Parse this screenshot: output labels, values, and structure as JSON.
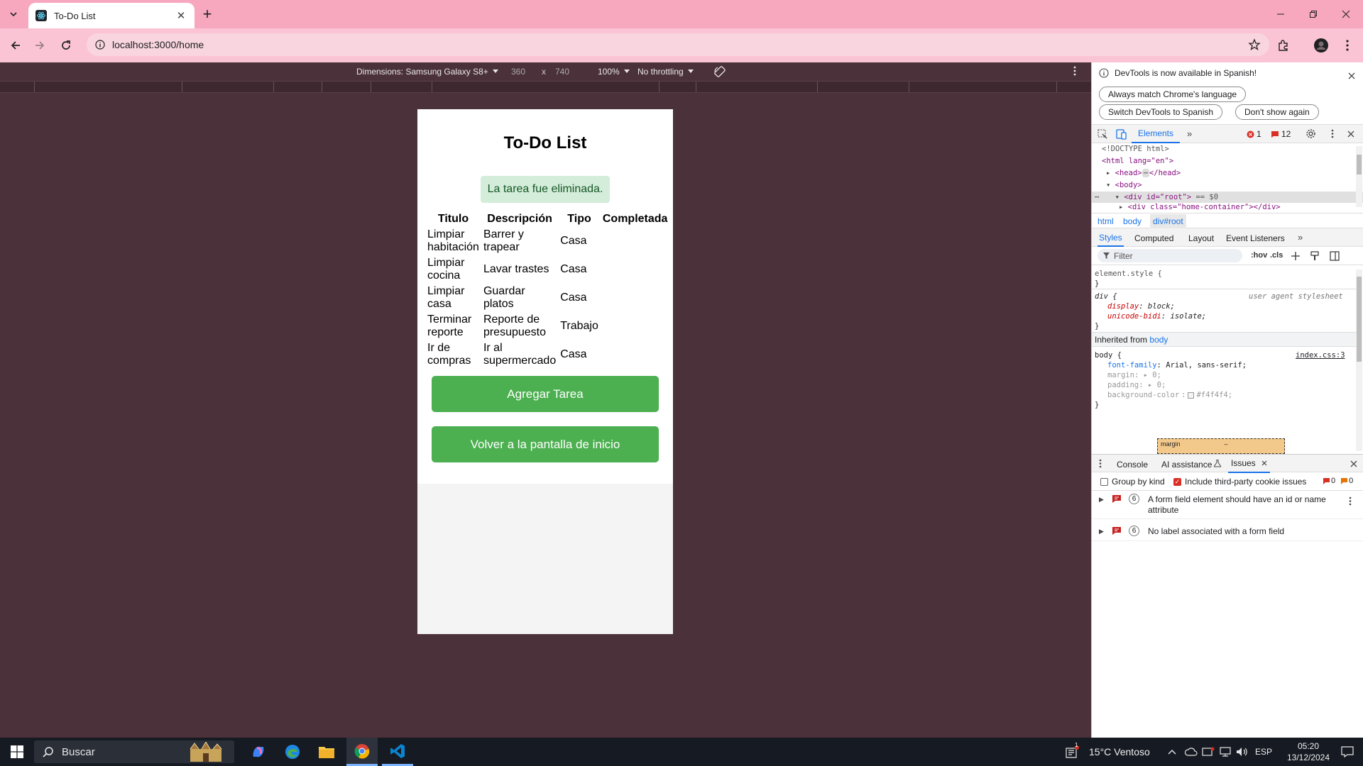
{
  "browser": {
    "tab_title": "To-Do List",
    "new_tab": "+",
    "url": "localhost:3000/home"
  },
  "device_toolbar": {
    "dimensions": "Dimensions: Samsung Galaxy S8+",
    "width": "360",
    "times": "x",
    "height": "740",
    "zoom": "100%",
    "throttling": "No throttling"
  },
  "app": {
    "title": "To-Do List",
    "alert": "La tarea fue eliminada.",
    "columns": [
      "Titulo",
      "Descripción",
      "Tipo",
      "Completada"
    ],
    "rows": [
      {
        "titulo": "Limpiar habitación",
        "descripcion": "Barrer y trapear",
        "tipo": "Casa",
        "completada": ""
      },
      {
        "titulo": "Limpiar cocina",
        "descripcion": "Lavar trastes",
        "tipo": "Casa",
        "completada": ""
      },
      {
        "titulo": "Limpiar casa",
        "descripcion": "Guardar platos",
        "tipo": "Casa",
        "completada": ""
      },
      {
        "titulo": "Terminar reporte",
        "descripcion": "Reporte de presupuesto",
        "tipo": "Trabajo",
        "completada": ""
      },
      {
        "titulo": "Ir de compras",
        "descripcion": "Ir al supermercado",
        "tipo": "Casa",
        "completada": ""
      }
    ],
    "add_button": "Agregar Tarea",
    "back_button": "Volver a la pantalla de inicio"
  },
  "devtools": {
    "info_message": "DevTools is now available in Spanish!",
    "btn_match": "Always match Chrome's language",
    "btn_switch": "Switch DevTools to Spanish",
    "btn_dont_show": "Don't show again",
    "tab_elements": "Elements",
    "more_tabs": "»",
    "error_count": "1",
    "message_count": "12",
    "dom": {
      "doctype": "<!DOCTYPE html>",
      "html_open": "<html lang=\"en\">",
      "head": "<head>",
      "head_close": "</head>",
      "body": "<body>",
      "root": "<div id=\"root\">",
      "root_ref": " == $0",
      "home": "<div class=\"home-container\">",
      "home_tail": "</div>"
    },
    "crumbs": [
      "html",
      "body",
      "div#root"
    ],
    "sub_tabs": [
      "Styles",
      "Computed",
      "Layout",
      "Event Listeners"
    ],
    "filter_placeholder": "Filter",
    "hov": ":hov",
    "cls": ".cls",
    "styles": {
      "element_style": "element.style {",
      "close": "}",
      "div_selector": "div {",
      "ua_label": "user agent stylesheet",
      "display_prop": "display",
      "display_val": "block;",
      "bidi_prop": "unicode-bidi",
      "bidi_val": "isolate;",
      "inherited": "Inherited from",
      "inherited_from": "body",
      "body_selector": "body {",
      "source": "index.css:3",
      "ff_prop": "font-family",
      "ff_val": "Arial, sans-serif;",
      "margin_prop": "margin",
      "margin_val": "0;",
      "padding_prop": "padding",
      "padding_val": "0;",
      "bg_prop": "background-color",
      "bg_val": "#f4f4f4;",
      "box_label": "margin",
      "box_dash": "–"
    },
    "drawer_tabs": [
      "Console",
      "AI assistance",
      "Issues"
    ],
    "group_by_kind": "Group by kind",
    "include_third_party": "Include third-party cookie issues",
    "issue_counts": [
      "0",
      "0"
    ],
    "issues": [
      {
        "count": "6",
        "text": "A form field element should have an id or name attribute"
      },
      {
        "count": "6",
        "text": "No label associated with a form field"
      }
    ]
  },
  "taskbar": {
    "search": "Buscar",
    "weather": "15°C  Ventoso",
    "lang": "ESP",
    "time": "05:20",
    "date": "13/12/2024",
    "notification_badge": "1"
  }
}
